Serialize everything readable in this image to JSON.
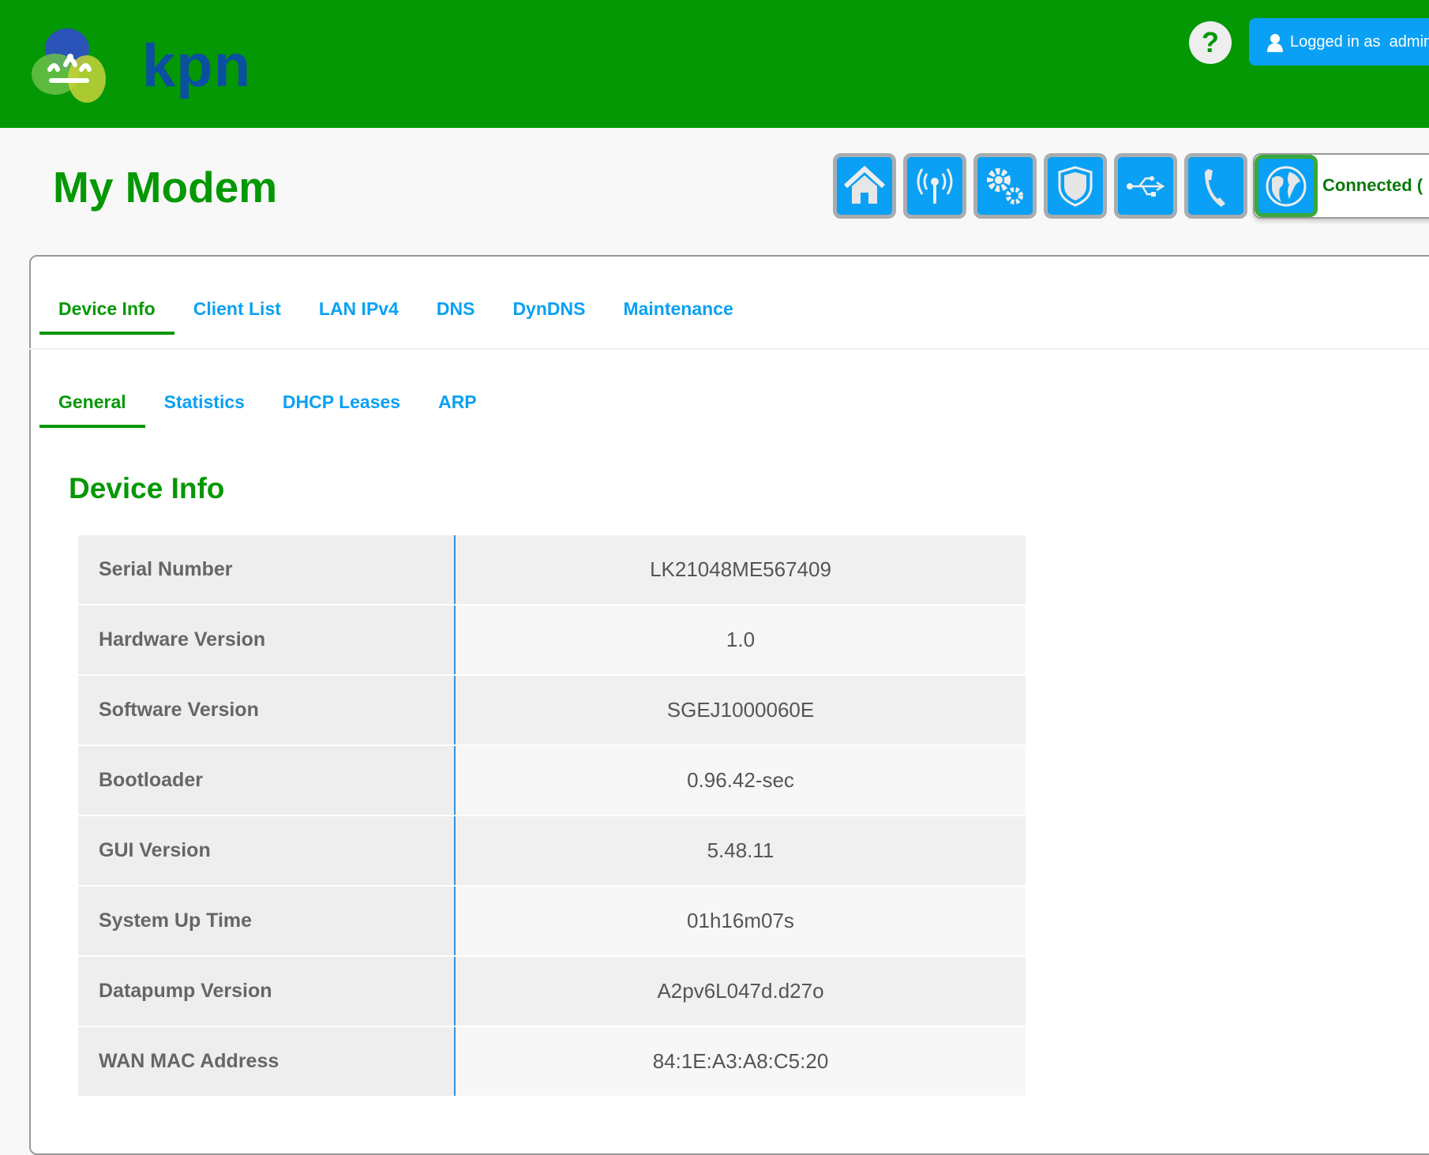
{
  "header": {
    "logo_text": "kpn",
    "help_label": "?",
    "login_label": "Logged in as",
    "login_user": "admin"
  },
  "page_title": "My Modem",
  "nav_icons": [
    "home-icon",
    "wifi-icon",
    "settings-icon",
    "security-icon",
    "usb-icon",
    "phone-icon"
  ],
  "status": {
    "label": "Connected (",
    "icon": "globe-icon"
  },
  "tabs": [
    "Device Info",
    "Client List",
    "LAN IPv4",
    "DNS",
    "DynDNS",
    "Maintenance"
  ],
  "subtabs": [
    "General",
    "Statistics",
    "DHCP Leases",
    "ARP"
  ],
  "section_title": "Device Info",
  "rows": [
    {
      "label": "Serial Number",
      "value": "LK21048ME567409"
    },
    {
      "label": "Hardware Version",
      "value": "1.0"
    },
    {
      "label": "Software Version",
      "value": "SGEJ1000060E"
    },
    {
      "label": "Bootloader",
      "value": "0.96.42-sec"
    },
    {
      "label": "GUI Version",
      "value": "5.48.11"
    },
    {
      "label": "System Up Time",
      "value": "01h16m07s"
    },
    {
      "label": "Datapump Version",
      "value": "A2pv6L047d.d27o"
    },
    {
      "label": "WAN MAC Address",
      "value": "84:1E:A3:A8:C5:20"
    }
  ],
  "colors": {
    "brand_green": "#049804",
    "accent_blue": "#0aa0f5"
  }
}
